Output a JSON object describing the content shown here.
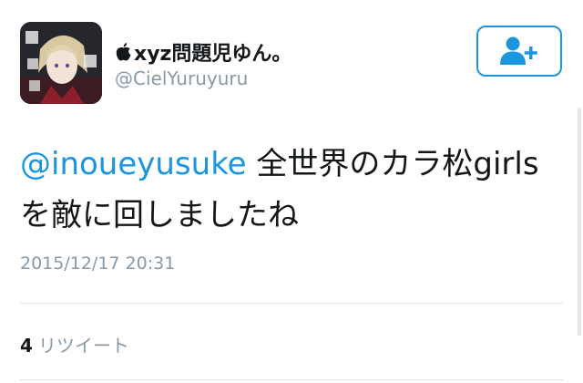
{
  "profile": {
    "display_name": "xyz問題児ゆん。",
    "handle": "@CielYuruyuru",
    "avatar_icon": "anime-avatar",
    "name_prefix_icon": "apple-icon"
  },
  "follow_button": {
    "icon": "add-user-icon",
    "color": "#1b95e0"
  },
  "tweet": {
    "mention": "@inoueyusuke",
    "text_line1_rest": " 全世界のカラ松girls",
    "text_line2": "を敵に回しましたね",
    "timestamp": "2015/12/17 20:31"
  },
  "stats": {
    "retweet_count": "4",
    "retweet_label": "リツイート"
  },
  "colors": {
    "accent": "#1b95e0",
    "muted": "#8899a6",
    "divider": "#e1e8ed",
    "text": "#14171a"
  }
}
